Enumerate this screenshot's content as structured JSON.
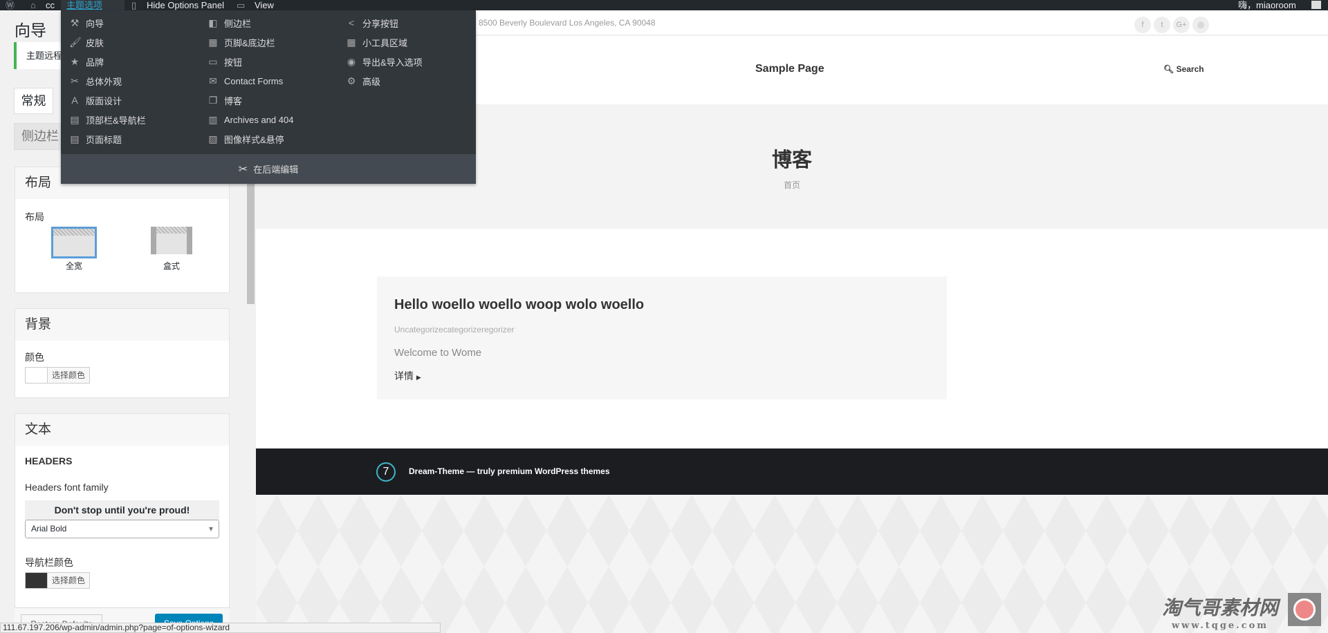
{
  "adminbar": {
    "site": "cc",
    "theme_options": "主题选项",
    "hide_panel": "Hide Options Panel",
    "view": "View",
    "greeting": "嗨，miaoroom"
  },
  "left": {
    "title": "向导",
    "notice": "主题远程",
    "tabs": [
      "常规",
      "侧边栏"
    ],
    "layout_box": {
      "title": "布局",
      "label": "布局",
      "options": [
        {
          "label": "全宽",
          "selected": true
        },
        {
          "label": "盒式",
          "selected": false
        }
      ]
    },
    "bg_box": {
      "title": "背景",
      "label": "颜色",
      "button": "选择颜色",
      "color": "#ffffff"
    },
    "text_box": {
      "title": "文本",
      "section": "HEADERS",
      "font_label": "Headers font family",
      "preview": "Don't stop until you're proud!",
      "font_value": "Arial Bold",
      "nav_label": "导航栏颜色",
      "nav_button": "选择颜色",
      "nav_color": "#333333"
    },
    "restore": "Restore Defaults",
    "save": "Save Options"
  },
  "menu": {
    "columns": [
      [
        {
          "icon": "wand-icon",
          "g": "⚒",
          "label": "向导"
        },
        {
          "icon": "brush-icon",
          "g": "🖌",
          "label": "皮肤"
        },
        {
          "icon": "star-icon",
          "g": "★",
          "label": "品牌"
        },
        {
          "icon": "tools-icon",
          "g": "✂",
          "label": "总体外观"
        },
        {
          "icon": "font-icon",
          "g": "A",
          "label": "版面设计"
        },
        {
          "icon": "header-icon",
          "g": "▤",
          "label": "顶部栏&导航栏"
        },
        {
          "icon": "page-title-icon",
          "g": "▤",
          "label": "页面标题"
        }
      ],
      [
        {
          "icon": "sidebar-icon",
          "g": "◧",
          "label": "侧边栏"
        },
        {
          "icon": "footer-icon",
          "g": "▦",
          "label": "页脚&底边栏"
        },
        {
          "icon": "button-icon",
          "g": "▭",
          "label": "按钮"
        },
        {
          "icon": "mail-icon",
          "g": "✉",
          "label": "Contact Forms"
        },
        {
          "icon": "blog-icon",
          "g": "❐",
          "label": "博客"
        },
        {
          "icon": "archive-icon",
          "g": "▥",
          "label": "Archives and 404"
        },
        {
          "icon": "image-icon",
          "g": "▨",
          "label": "图像样式&悬停"
        }
      ],
      [
        {
          "icon": "share-icon",
          "g": "<",
          "label": "分享按钮"
        },
        {
          "icon": "widgets-icon",
          "g": "▦",
          "label": "小工具区域"
        },
        {
          "icon": "import-export-icon",
          "g": "◉",
          "label": "导出&导入选项"
        },
        {
          "icon": "gears-icon",
          "g": "⚙",
          "label": "高级"
        }
      ]
    ],
    "footer": "在后端编辑"
  },
  "preview": {
    "address": "8500 Beverly Boulevard Los Angeles, CA 90048",
    "social": [
      "f",
      "t",
      "G+",
      "◎"
    ],
    "nav": "Sample Page",
    "search": "Search",
    "page_title": "博客",
    "breadcrumb": "首页",
    "post": {
      "title": "Hello woello woello woop wolo woello",
      "category": "Uncategorizecategorizeregorizer",
      "excerpt": "Welcome to Wome",
      "more": "详情"
    },
    "footer_logo": "7",
    "footer_text": "Dream-Theme — truly premium WordPress themes"
  },
  "status_url": "111.67.197.206/wp-admin/admin.php?page=of-options-wizard",
  "watermark": {
    "title": "淘气哥素材网",
    "url": "www.tqge.com"
  },
  "colors": {
    "accent": "#2ea2cc",
    "notice": "#46b450",
    "footer": "#1b1d21"
  }
}
